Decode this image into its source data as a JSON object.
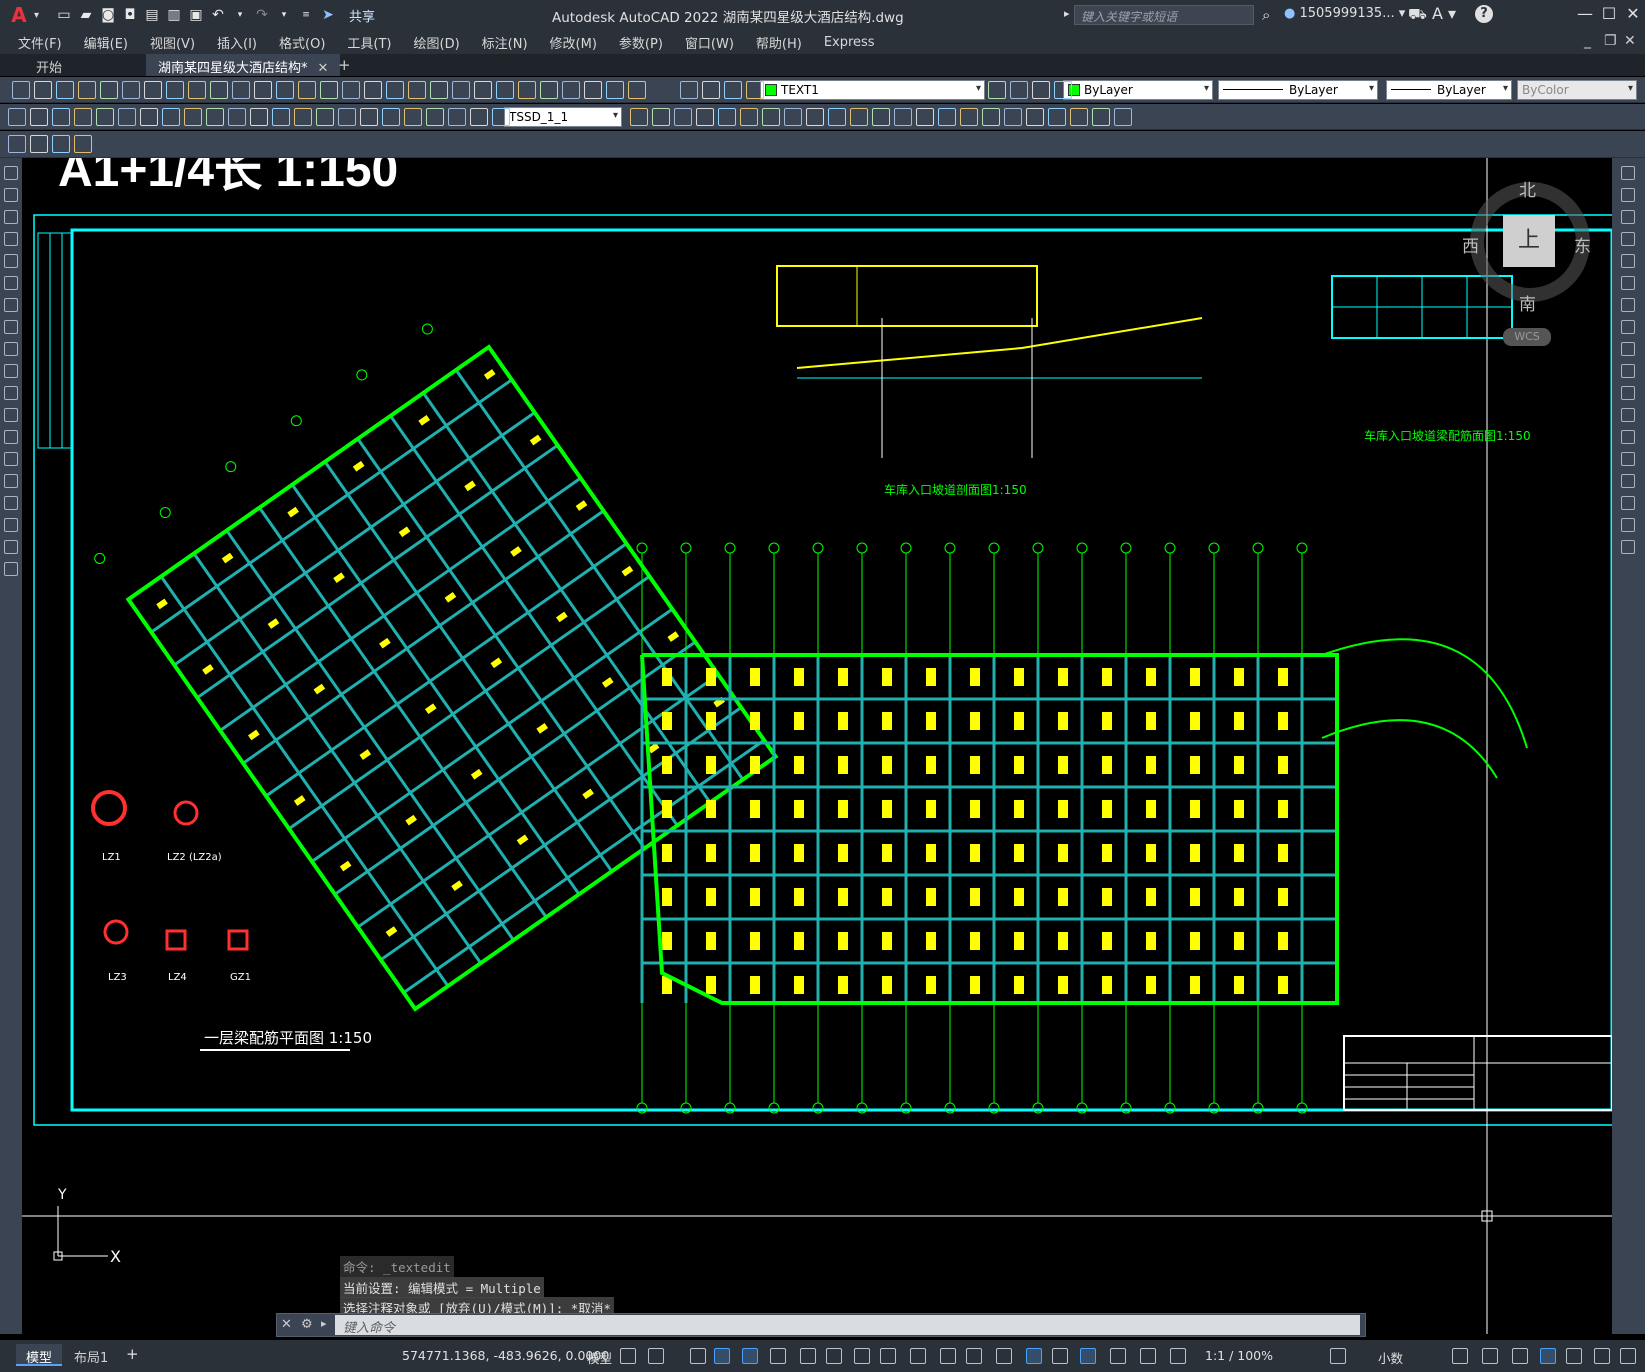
{
  "app": {
    "title": "Autodesk AutoCAD 2022    湖南某四星级大酒店结构.dwg",
    "logo": "A",
    "share_label": "共享",
    "search_placeholder": "键入关键字或短语",
    "user": "1505999135...",
    "accent_color": "#e8323c"
  },
  "menu": [
    "文件(F)",
    "编辑(E)",
    "视图(V)",
    "插入(I)",
    "格式(O)",
    "工具(T)",
    "绘图(D)",
    "标注(N)",
    "修改(M)",
    "参数(P)",
    "窗口(W)",
    "帮助(H)",
    "Express"
  ],
  "tabs": [
    {
      "label": "开始",
      "active": false
    },
    {
      "label": "湖南某四星级大酒店结构*",
      "active": true,
      "close": "✕"
    }
  ],
  "tab_add": "+",
  "toolbar": {
    "layer_value": "TEXT1",
    "color_value": "ByLayer",
    "linetype_value": "ByLayer",
    "lineweight_value": "ByLayer",
    "plotstyle_value": "ByColor",
    "dimstyle_value": "TSSD_1_1"
  },
  "viewcube": {
    "north": "北",
    "south": "南",
    "east": "东",
    "west": "西",
    "face": "上",
    "wcs": "WCS"
  },
  "drawing": {
    "title_fragment": "A1+1/4长          1:150",
    "section_title": "车库入口坡道剖面图1:150",
    "beam_title": "车库入口坡道梁配筋面图1:150",
    "plan_title": "一层梁配筋平面图  1:150",
    "col_labels": [
      "LZ1",
      "LZ2 (LZ2a)",
      "LZ3",
      "LZ4",
      "GZ1"
    ],
    "ucs_y": "Y",
    "ucs_x": "X"
  },
  "command_history": [
    "命令: _textedit",
    "当前设置: 编辑模式 = Multiple",
    "选择注释对象或 [放弃(U)/模式(M)]: *取消*"
  ],
  "command_placeholder": "键入命令",
  "status": {
    "layout_tabs": [
      "模型",
      "布局1"
    ],
    "add_layout": "+",
    "coords": "574771.1368, -483.9626, 0.0000",
    "model_label": "模型",
    "scale": "1:1 / 100%",
    "units": "小数"
  }
}
